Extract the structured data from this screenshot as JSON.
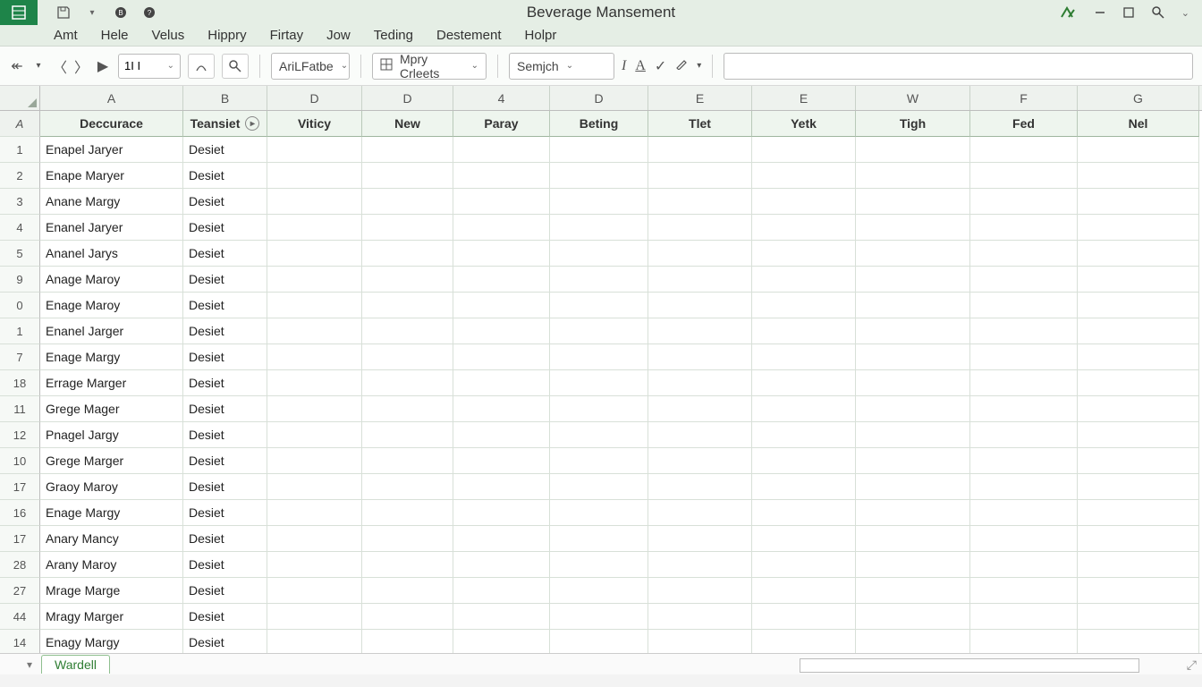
{
  "title": "Beverage Mansement",
  "menus": [
    "Amt",
    "Hele",
    "Velus",
    "Hippry",
    "Firtay",
    "Jow",
    "Teding",
    "Destement",
    "Holpr"
  ],
  "toolbar": {
    "namebox": "1I I",
    "combo1": "AriLFatbe",
    "combo2": "Mpry Crleets",
    "combo3": "Semjch"
  },
  "colLetters": [
    "A",
    "B",
    "D",
    "D",
    "4",
    "D",
    "E",
    "E",
    "W",
    "F",
    "G"
  ],
  "headers": [
    "Deccurace",
    "Teansiet",
    "Viticy",
    "New",
    "Paray",
    "Beting",
    "Tlet",
    "Yetk",
    "Tigh",
    "Fed",
    "Nel"
  ],
  "rowNums": [
    "1",
    "2",
    "3",
    "4",
    "5",
    "9",
    "0",
    "1",
    "7",
    "18",
    "11",
    "12",
    "10",
    "17",
    "16",
    "17",
    "28",
    "27",
    "44",
    "14"
  ],
  "rows": [
    {
      "a": "Enapel Jaryer",
      "b": "Desiet"
    },
    {
      "a": "Enape Maryer",
      "b": "Desiet"
    },
    {
      "a": "Anane Margy",
      "b": "Desiet"
    },
    {
      "a": "Enanel Jaryer",
      "b": "Desiet"
    },
    {
      "a": "Ananel Jarys",
      "b": "Desiet"
    },
    {
      "a": "Anage Maroy",
      "b": "Desiet"
    },
    {
      "a": "Enage Maroy",
      "b": "Desiet"
    },
    {
      "a": "Enanel Jarger",
      "b": "Desiet"
    },
    {
      "a": "Enage Margy",
      "b": "Desiet"
    },
    {
      "a": "Errage Marger",
      "b": "Desiet"
    },
    {
      "a": "Grege Mager",
      "b": "Desiet"
    },
    {
      "a": "Pnagel Jargy",
      "b": "Desiet"
    },
    {
      "a": "Grege Marger",
      "b": "Desiet"
    },
    {
      "a": "Graoy Maroy",
      "b": "Desiet"
    },
    {
      "a": "Enage Margy",
      "b": "Desiet"
    },
    {
      "a": "Anary Mancy",
      "b": "Desiet"
    },
    {
      "a": "Arany Maroy",
      "b": "Desiet"
    },
    {
      "a": "Mrage Marge",
      "b": "Desiet"
    },
    {
      "a": "Mragy Marger",
      "b": "Desiet"
    },
    {
      "a": "Enagy Margy",
      "b": "Desiet"
    }
  ],
  "sheet": "Wardell"
}
